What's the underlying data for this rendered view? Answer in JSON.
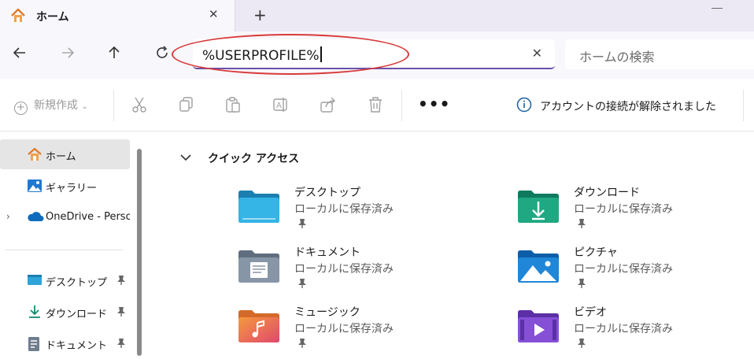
{
  "tab": {
    "title": "ホーム"
  },
  "address": {
    "value": "%USERPROFILE%"
  },
  "search": {
    "placeholder": "ホームの検索"
  },
  "toolbar": {
    "new_label": "新規作成",
    "info_text": "アカウントの接続が解除されました"
  },
  "sidebar": {
    "items": [
      {
        "label": "ホーム",
        "icon": "home-icon"
      },
      {
        "label": "ギャラリー",
        "icon": "gallery-icon"
      },
      {
        "label": "OneDrive - Perso",
        "icon": "onedrive-icon"
      },
      {
        "label": "デスクトップ",
        "icon": "desktop-folder-icon"
      },
      {
        "label": "ダウンロード",
        "icon": "download-icon"
      },
      {
        "label": "ドキュメント",
        "icon": "document-icon"
      }
    ]
  },
  "quick_access": {
    "title": "クイック アクセス",
    "items": [
      {
        "name": "デスクトップ",
        "sub": "ローカルに保存済み",
        "icon": "desktop-folder-icon"
      },
      {
        "name": "ダウンロード",
        "sub": "ローカルに保存済み",
        "icon": "downloads-folder-icon"
      },
      {
        "name": "ドキュメント",
        "sub": "ローカルに保存済み",
        "icon": "documents-folder-icon"
      },
      {
        "name": "ピクチャ",
        "sub": "ローカルに保存済み",
        "icon": "pictures-folder-icon"
      },
      {
        "name": "ミュージック",
        "sub": "ローカルに保存済み",
        "icon": "music-folder-icon"
      },
      {
        "name": "ビデオ",
        "sub": "ローカルに保存済み",
        "icon": "videos-folder-icon"
      }
    ]
  },
  "colors": {
    "accent": "#6a52a8",
    "highlight": "#d93a3a",
    "tab_bar": "#ece9f4"
  }
}
